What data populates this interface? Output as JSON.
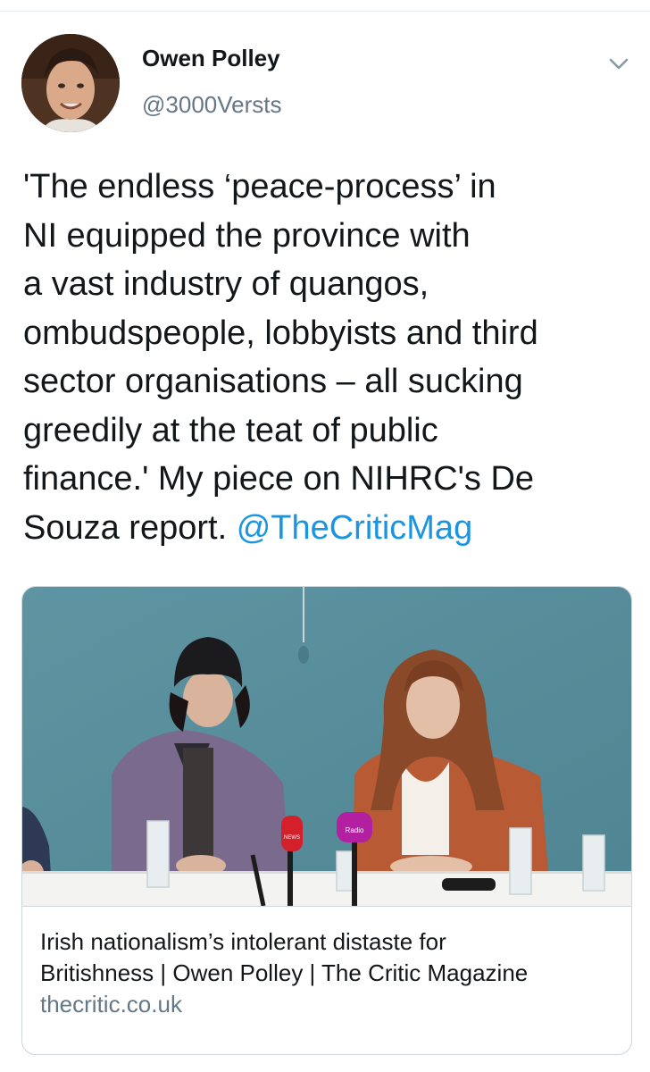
{
  "tweet": {
    "author": {
      "display_name": "Owen Polley",
      "handle": "@3000Versts"
    },
    "text_lines": [
      "'The endless ‘peace-process’ in",
      "NI equipped the province with",
      "a vast industry of quangos,",
      "ombudspeople, lobbyists and third",
      "sector organisations – all sucking",
      "greedily at the teat of public",
      "finance.' My piece on NIHRC's De",
      "Souza report. "
    ],
    "mention": "@TheCriticMag",
    "card": {
      "title_lines": [
        "Irish nationalism’s intolerant distaste for",
        "Britishness | Owen Polley | The Critic Magazine"
      ],
      "domain": "thecritic.co.uk",
      "mic_labels": [
        "NEWS",
        "Radio"
      ]
    },
    "icons": {
      "avatar": "profile-photo",
      "menu": "chevron-down-icon"
    },
    "colors": {
      "link": "#1b95e0",
      "secondary_text": "#657786",
      "border": "#ccd6dd"
    }
  }
}
